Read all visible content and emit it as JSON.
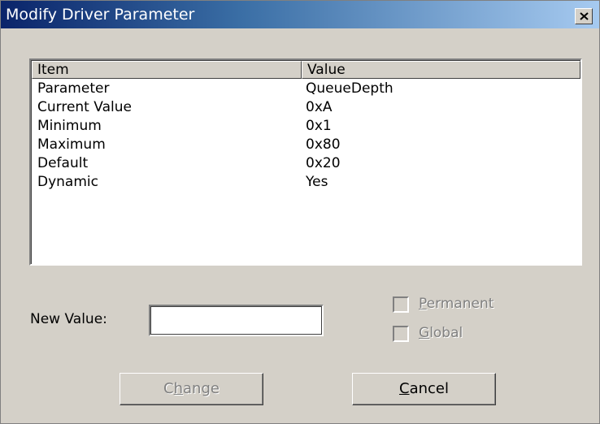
{
  "window": {
    "title": "Modify Driver Parameter"
  },
  "list": {
    "columns": [
      {
        "label": "Item"
      },
      {
        "label": "Value"
      }
    ],
    "rows": [
      {
        "item": "Parameter",
        "value": "QueueDepth"
      },
      {
        "item": "Current Value",
        "value": "0xA"
      },
      {
        "item": "Minimum",
        "value": "0x1"
      },
      {
        "item": "Maximum",
        "value": "0x80"
      },
      {
        "item": "Default",
        "value": "0x20"
      },
      {
        "item": "Dynamic",
        "value": "Yes"
      }
    ]
  },
  "form": {
    "new_value_label": "New Value:",
    "new_value": "",
    "permanent": {
      "label_prefix": "",
      "mnemonic": "P",
      "label_rest": "ermanent",
      "checked": false,
      "enabled": false
    },
    "global": {
      "label_prefix": "",
      "mnemonic": "G",
      "label_rest": "lobal",
      "checked": false,
      "enabled": false
    }
  },
  "buttons": {
    "change": {
      "prefix": "C",
      "mnemonic": "h",
      "rest": "ange",
      "enabled": false
    },
    "cancel": {
      "prefix": "",
      "mnemonic": "C",
      "rest": "ancel",
      "enabled": true
    }
  },
  "icons": {
    "close": "close-icon"
  },
  "colors": {
    "titlebar_start": "#0a246a",
    "titlebar_end": "#a6caf0",
    "face": "#d4d0c8"
  }
}
